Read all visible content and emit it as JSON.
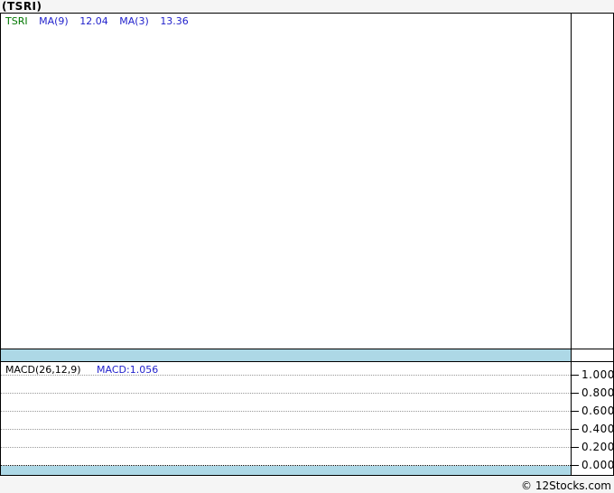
{
  "header": {
    "title": "(TSRI)"
  },
  "main_chart": {
    "symbol": "TSRI",
    "indicators": [
      {
        "label": "MA(9)",
        "value": "12.04"
      },
      {
        "label": "MA(3)",
        "value": "13.36"
      }
    ]
  },
  "macd_panel": {
    "label": "MACD(26,12,9)",
    "value_label": "MACD:1.056",
    "axis_labels": [
      "1.000",
      "0.800",
      "0.600",
      "0.400",
      "0.200",
      "0.000"
    ]
  },
  "footer": {
    "watermark": "© 12Stocks.com"
  },
  "colors": {
    "background": "#f5f5f5",
    "panel_background": "#ffffff",
    "separator_band": "#add8e6",
    "border": "#000000",
    "symbol_green": "#007700",
    "indicator_blue": "#2222cc",
    "grid_gray": "#999999"
  },
  "chart_data": [
    {
      "type": "line",
      "title": "TSRI price chart",
      "series": [
        {
          "name": "MA(9)",
          "latest_value": 12.04
        },
        {
          "name": "MA(3)",
          "latest_value": 13.36
        }
      ],
      "x": [],
      "note": "plot area rendered empty in screenshot",
      "grid": false,
      "legend_position": "top-left"
    },
    {
      "type": "line",
      "title": "MACD(26,12,9)",
      "series": [
        {
          "name": "MACD",
          "latest_value": 1.056
        }
      ],
      "x": [],
      "ylabel": "",
      "ylim": [
        0.0,
        1.0
      ],
      "yticks": [
        1.0,
        0.8,
        0.6,
        0.4,
        0.2,
        0.0
      ],
      "grid": true,
      "grid_style": "dotted-horizontal",
      "legend_position": "top-left"
    }
  ]
}
